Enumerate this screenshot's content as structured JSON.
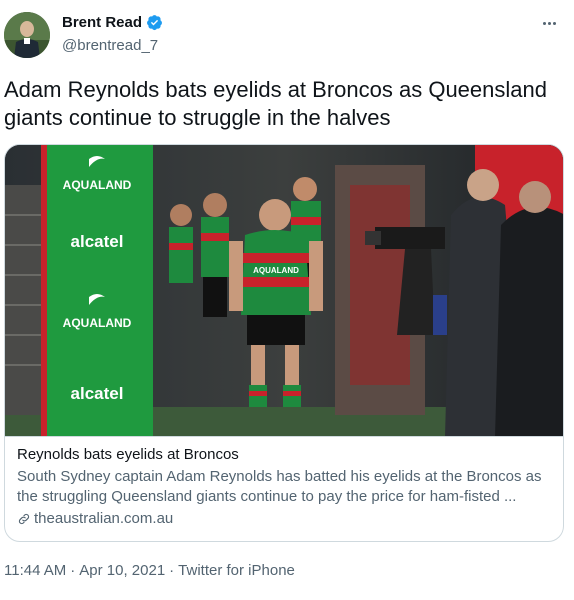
{
  "author": {
    "display_name": "Brent Read",
    "handle": "@brentread_7",
    "verified": true
  },
  "tweet": {
    "text": "Adam Reynolds bats eyelids at Broncos as Queensland giants continue to struggle in the halves"
  },
  "card": {
    "image_signage": {
      "brand_a": "AQUALAND",
      "brand_b": "alcatel",
      "brand_b_partial": "atel",
      "jersey_sponsor": "AQUALAND"
    },
    "title": "Reynolds bats eyelids at Broncos",
    "description": "South Sydney captain Adam Reynolds has batted his eyelids at the Broncos as the struggling Queensland giants continue to pay the price for ham-fisted ...",
    "domain": "theaustralian.com.au"
  },
  "meta": {
    "time": "11:44 AM",
    "date": "Apr 10, 2021",
    "separator": "·",
    "source": "Twitter for iPhone"
  },
  "colors": {
    "verified_blue": "#1d9bf0",
    "text_primary": "#0f1419",
    "text_secondary": "#536471",
    "border": "#cfd9de",
    "jersey_green": "#1e8a3e",
    "jersey_red": "#c8222b"
  },
  "icons": {
    "verified": "verified-badge-icon",
    "more": "more-icon",
    "link": "link-icon"
  }
}
